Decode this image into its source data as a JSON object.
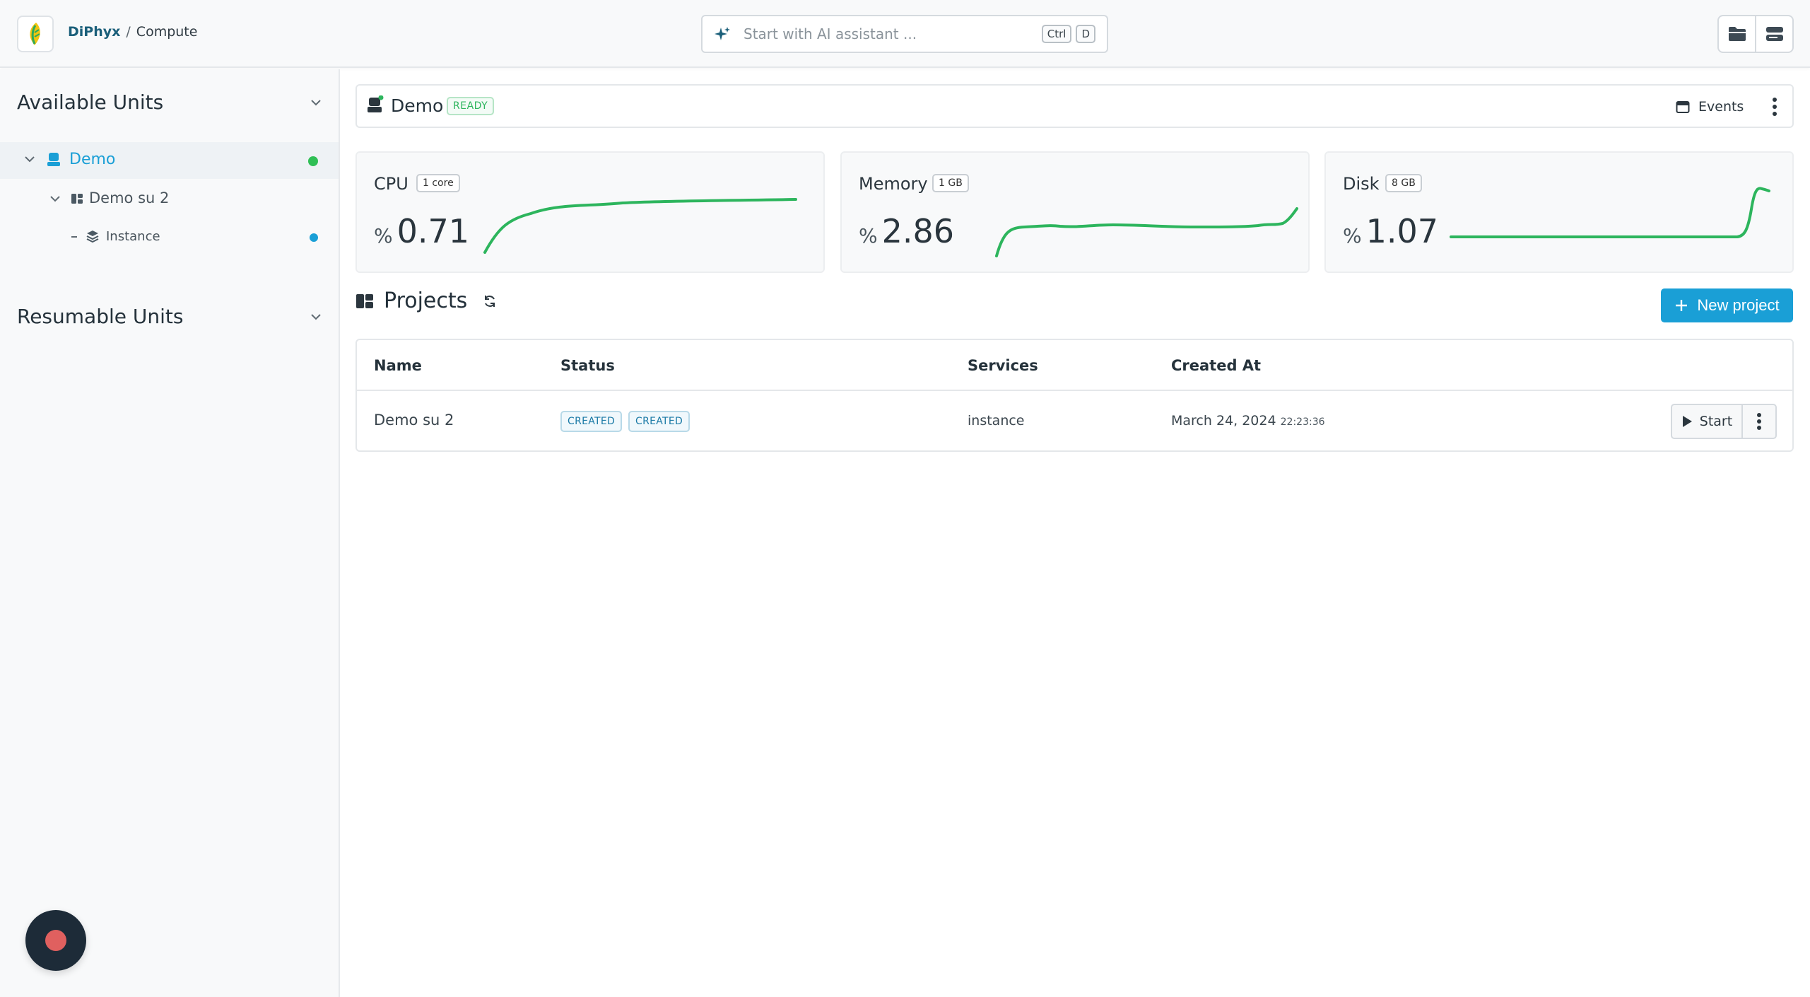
{
  "app": {
    "brand": "DiPhyx",
    "separator": "/",
    "section": "Compute"
  },
  "ai_search": {
    "placeholder": "Start with AI assistant ...",
    "shortcut_mod": "Ctrl",
    "shortcut_key": "D"
  },
  "sidebar": {
    "available_title": "Available Units",
    "resumable_title": "Resumable Units",
    "tree": {
      "unit": "Demo",
      "project": "Demo su 2",
      "service": "Instance"
    }
  },
  "unit": {
    "name": "Demo",
    "status": "READY",
    "events_label": "Events"
  },
  "metrics": {
    "cpu": {
      "name": "CPU",
      "capacity": "1 core",
      "unit": "%",
      "value": "0.71"
    },
    "memory": {
      "name": "Memory",
      "capacity": "1 GB",
      "unit": "%",
      "value": "2.86"
    },
    "disk": {
      "name": "Disk",
      "capacity": "8 GB",
      "unit": "%",
      "value": "1.07"
    }
  },
  "projects": {
    "title": "Projects",
    "new_label": "New project",
    "columns": [
      "Name",
      "Status",
      "Services",
      "Created At"
    ],
    "rows": [
      {
        "name": "Demo su 2",
        "status": [
          "CREATED",
          "CREATED"
        ],
        "services": "instance",
        "created_date": "March 24, 2024",
        "created_time": "22:23:36",
        "action": "Start"
      }
    ]
  },
  "colors": {
    "accent": "#1a9fd6",
    "sparkline": "#2db55d",
    "ready": "#2db55d",
    "online_dot": "#2fbf55",
    "instance_dot": "#1a9fd6",
    "record": "#e0605f"
  }
}
